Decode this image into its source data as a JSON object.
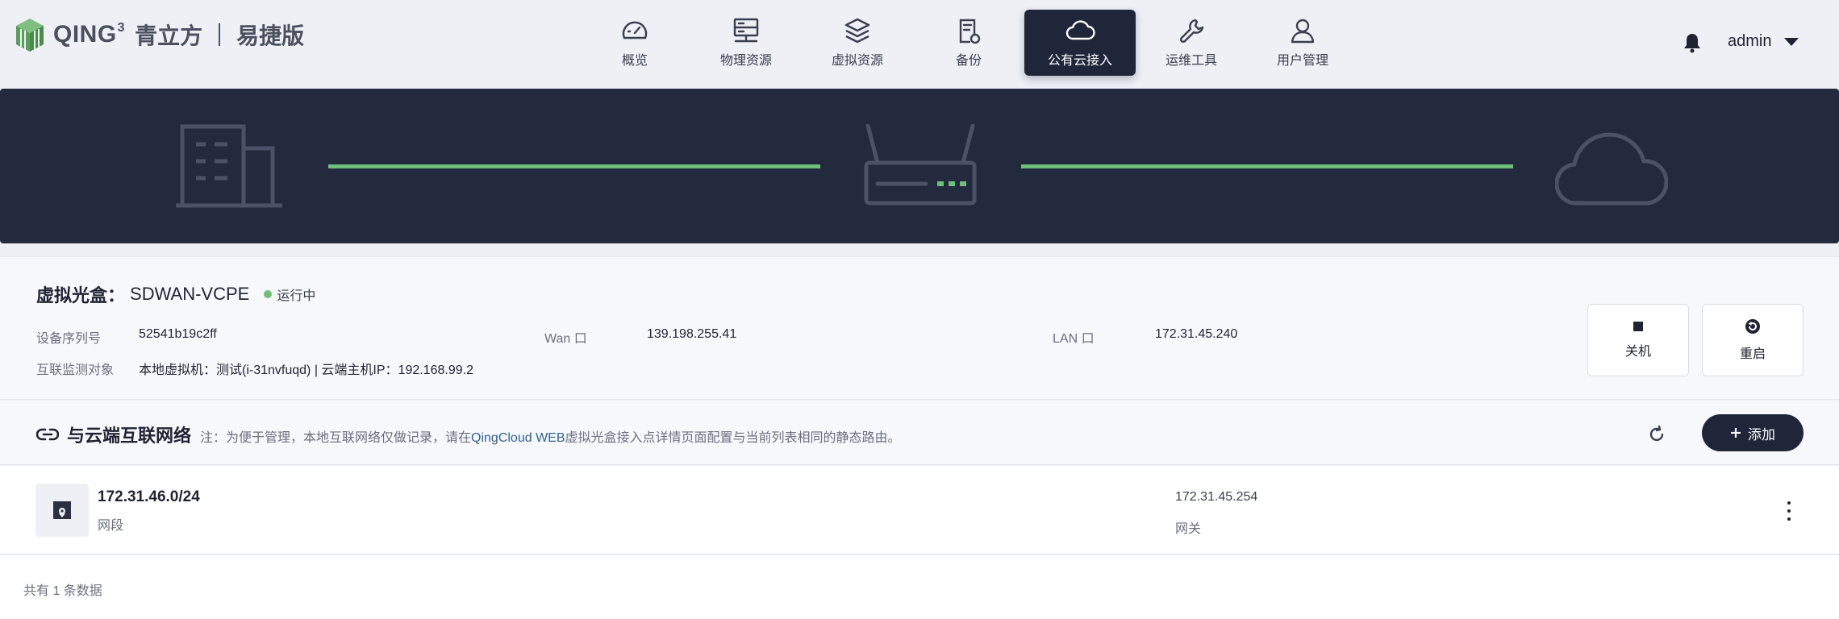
{
  "brand": {
    "name": "QING",
    "sup": "3",
    "cn": "青立方",
    "edition": "易捷版"
  },
  "nav": {
    "items": [
      {
        "label": "概览",
        "icon": "dashboard-gauge-icon"
      },
      {
        "label": "物理资源",
        "icon": "server-icon"
      },
      {
        "label": "虚拟资源",
        "icon": "layers-icon"
      },
      {
        "label": "备份",
        "icon": "backup-document-icon"
      },
      {
        "label": "公有云接入",
        "icon": "cloud-icon",
        "active": true
      },
      {
        "label": "运维工具",
        "icon": "wrench-icon"
      },
      {
        "label": "用户管理",
        "icon": "user-icon"
      }
    ]
  },
  "header": {
    "user": "admin"
  },
  "device": {
    "title_key": "虚拟光盒：",
    "title_value": "SDWAN-VCPE",
    "status": "运行中",
    "fields": {
      "serial_label": "设备序列号",
      "serial_value": "52541b19c2ff",
      "wan_label": "Wan 口",
      "wan_value": "139.198.255.41",
      "lan_label": "LAN 口",
      "lan_value": "172.31.45.240",
      "monitor_label": "互联监测对象",
      "monitor_value": "本地虚拟机：测试(i-31nvfuqd) | 云端主机IP：192.168.99.2"
    },
    "actions": {
      "shutdown": "关机",
      "restart": "重启"
    }
  },
  "interconnect": {
    "title": "与云端互联网络",
    "note_prefix": "注：为便于管理，本地互联网络仅做记录，请在",
    "note_link": "QingCloud WEB",
    "note_suffix": "虚拟光盒接入点详情页面配置与当前列表相同的静态路由。",
    "add_label": "添加"
  },
  "rows": [
    {
      "cidr": "172.31.46.0/24",
      "cidr_label": "网段",
      "gateway": "172.31.45.254",
      "gateway_label": "网关"
    }
  ],
  "footer": {
    "total": "共有 1 条数据"
  },
  "colors": {
    "accent_dark": "#20263a",
    "banner_bg": "#242a3d",
    "status_green": "#6dbf7a",
    "link": "#2f5f8f"
  }
}
